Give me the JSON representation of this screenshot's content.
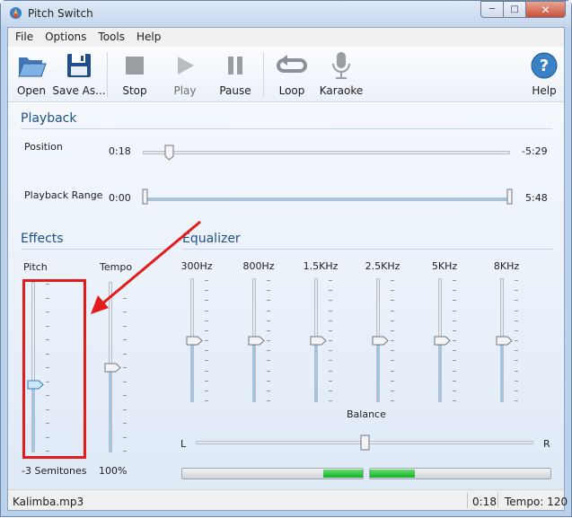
{
  "window": {
    "title": "Pitch Switch",
    "accent": "#3b82c4"
  },
  "menu": [
    "File",
    "Options",
    "Tools",
    "Help"
  ],
  "toolbar": {
    "open": "Open",
    "save": "Save As...",
    "stop": "Stop",
    "play": "Play",
    "pause": "Pause",
    "loop": "Loop",
    "karaoke": "Karaoke",
    "help": "Help"
  },
  "playback": {
    "header": "Playback",
    "position_label": "Position",
    "position_value": "0:18",
    "position_end": "-5:29",
    "position_fraction": 0.07,
    "range_label": "Playback Range",
    "range_start": "0:00",
    "range_end": "5:48"
  },
  "effects": {
    "header": "Effects",
    "pitch_label": "Pitch",
    "tempo_label": "Tempo",
    "pitch_value": "-3 Semitones",
    "tempo_value": "100%",
    "pitch_fraction": 0.4,
    "tempo_fraction": 0.5
  },
  "equalizer": {
    "header": "Equalizer",
    "bands": [
      {
        "label": "300Hz",
        "fraction": 0.5
      },
      {
        "label": "800Hz",
        "fraction": 0.5
      },
      {
        "label": "1.5KHz",
        "fraction": 0.5
      },
      {
        "label": "2.5KHz",
        "fraction": 0.5
      },
      {
        "label": "5KHz",
        "fraction": 0.5
      },
      {
        "label": "8KHz",
        "fraction": 0.5
      }
    ],
    "balance_label": "Balance",
    "balance_left": "L",
    "balance_right": "R",
    "balance_fraction": 0.5
  },
  "meters": {
    "left_level": 0.22,
    "right_level": 0.25,
    "color": "#22b531"
  },
  "status": {
    "file": "Kalimba.mp3",
    "time": "0:18",
    "tempo": "Tempo: 120"
  },
  "annotation_color": "#e31b1b"
}
